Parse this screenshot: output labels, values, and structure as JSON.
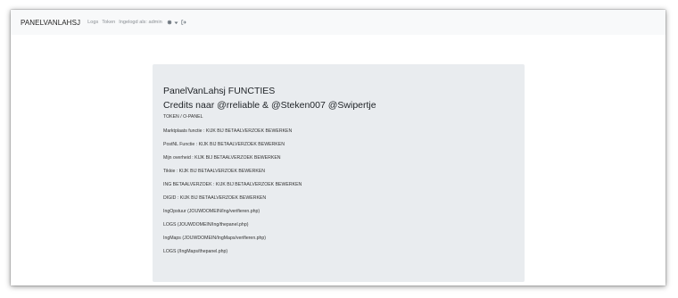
{
  "navbar": {
    "brand": "PANELVANLAHSJ",
    "links": [
      "Logs",
      "Token"
    ],
    "user_text": "Ingelogd als: admin",
    "icons": [
      "gear-icon",
      "caret-down-icon",
      "logout-icon"
    ]
  },
  "card": {
    "title": "PanelVanLahsj FUNCTIES",
    "credits": "Credits naar @rreliable & @Steken007 @Swipertje",
    "subtitle": "TOKEN / O-PANEL",
    "items": [
      "Marktplaats functie : KIJK BIJ BETAALVERZOEK BEWERKEN",
      "PostNL Functie : KIJK BIJ BETAALVERZOEK BEWERKEN",
      "Mijn overheid : KIJK BIJ BETAALVERZOEK BEWERKEN",
      "Tikkie : KIJK BIJ BETAALVERZOEK BEWERKEN",
      "ING BETAALVERZOEK : KIJK BIJ BETAALVERZOEK BEWERKEN",
      "DIGID : KIJK BIJ BETAALVERZOEK BEWERKEN",
      "IngOpstuur (JOUWDOMEIN/Ing/verifieren.php)",
      "LOGS (JOUWDOMEIN/Ing/thepanel.php)",
      "IngMaps (JOUWDOMEIN/IngMaps/verifieren.php)",
      "LOGS (/IngMaps/thepanel.php)"
    ]
  },
  "colors": {
    "navbar_bg": "#f8f9fa",
    "card_bg": "#e9ecef",
    "muted_link": "#8a8f94"
  }
}
